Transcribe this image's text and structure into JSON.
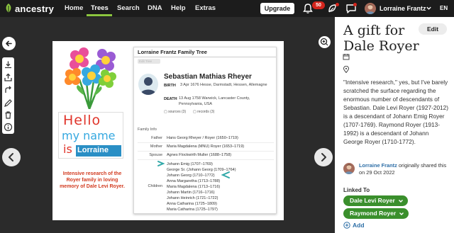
{
  "topnav": {
    "logo": "ancestry",
    "links": [
      "Home",
      "Trees",
      "Search",
      "DNA",
      "Help",
      "Extras"
    ],
    "active_link": "Trees",
    "upgrade_label": "Upgrade",
    "notification_count": "50",
    "user_name": "Lorraine Frantz",
    "language": "EN"
  },
  "viewer": {
    "poster": {
      "hello_words": [
        "Hello",
        "my name",
        "is",
        "Lorraine"
      ],
      "caption": "Intensive research of the Royer family in loving memory of Dale Levi Royer."
    },
    "card": {
      "title": "Lorraine Frantz Family Tree",
      "greybox_text": "Edit Tree",
      "person_name": "Sebastian Mathias Rheyer",
      "birth_label": "BIRTH",
      "birth_text": "3 Apr 1676 Hesse, Darmstadt, Hessen, Allemagne",
      "death_label": "DEATH",
      "death_text": "13 Aug 1758 Warwick, Lancaster County, Pennsylvania, USA",
      "sources": "sources (3)",
      "records": "records (3)",
      "family_heading": "Family Info",
      "father_label": "Father",
      "father_value": "Hans Georg Rheyer / Royer (1650–1719)",
      "mother_label": "Mother",
      "mother_value": "Maria Magdalena (MNU) Royer (1653–1719)",
      "spouse_label": "Spouse",
      "spouse_value": "Agnes Flockwirth Muller (1688–1758)",
      "children_label": "Children",
      "children": [
        "Johann Emig (1707–1769)",
        "George Sr. (Johann Georg (1709–1764)",
        "Johann Georg (1710–1772)",
        "Anna Margaretha (1713–1788)",
        "Maria Magdalena (1713–1716)",
        "Johann Martin (1716–1716)",
        "Johann Heinrich (1721–1722)",
        "Anna Catharina (1725–1809)",
        "Maria Catharina (1725–1797)"
      ]
    }
  },
  "panel": {
    "title": "A gift for Dale Royer",
    "edit_label": "Edit",
    "description": "\"Intensive research,\" yes, but I've barely scratched the surface regarding the enormous number of descendants of Sebastian. Dale Levi Royer (1927-2012)  is a descendant of Johann Emig Royer (1707-1769). Raymond Royer (1913-1992) is a descendant of Johann George Royer (1710-1772).",
    "sharer_name": "Lorraine Frantz",
    "sharer_suffix": " originally shared this on 29 Oct 2022",
    "linked_label": "Linked To",
    "linked": [
      "Dale Levi Royer",
      "Raymond Royer"
    ],
    "add_label": "Add"
  },
  "colors": {
    "brand_green": "#8cc63f",
    "pill_green": "#3a8f2c",
    "link_blue": "#2e6fa7",
    "notification_red": "#d4251c",
    "teal_scribble": "#2fa7a7"
  },
  "icons": [
    "leaf-logo-icon",
    "bell-icon",
    "hint-leaf-icon",
    "message-icon",
    "chevron-down-icon",
    "arrow-left-icon",
    "download-icon",
    "share-icon",
    "pencil-icon",
    "trash-icon",
    "info-icon",
    "zoom-in-icon",
    "chevron-left-icon",
    "chevron-right-icon",
    "calendar-icon",
    "location-pin-icon",
    "plus-circle-icon"
  ]
}
